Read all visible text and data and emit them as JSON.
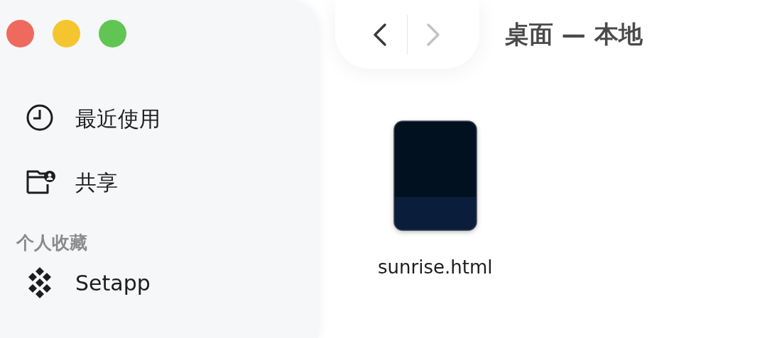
{
  "window": {
    "title": "桌面 — 本地"
  },
  "window_buttons": [
    {
      "kind": "close"
    },
    {
      "kind": "minimize"
    },
    {
      "kind": "zoom"
    }
  ],
  "navigation": [
    {
      "kind": "back",
      "disabled": false
    },
    {
      "kind": "forward",
      "disabled": true
    }
  ],
  "sidebar": {
    "items": [
      {
        "label": "最近使用"
      },
      {
        "label": "共享"
      }
    ],
    "sections": [
      {
        "header": "个人收藏",
        "items": [
          {
            "label": "Setapp"
          }
        ]
      }
    ]
  },
  "files": [
    {
      "name": "sunrise.html"
    }
  ]
}
